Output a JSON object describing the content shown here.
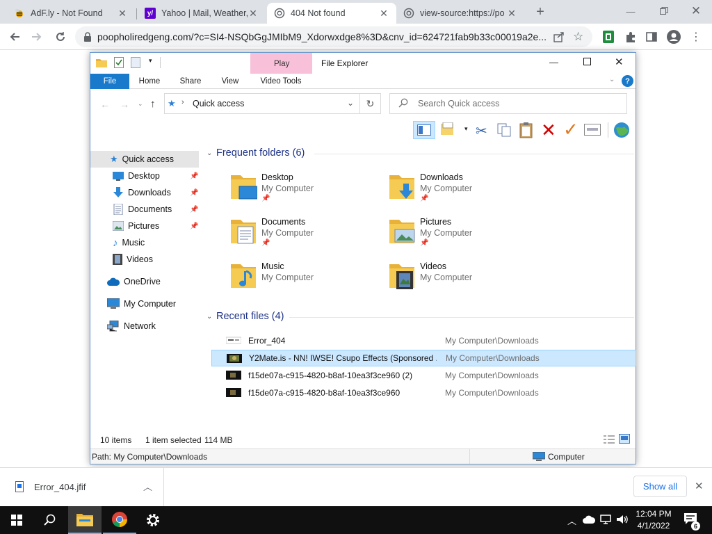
{
  "browser": {
    "tabs": [
      {
        "title": "AdF.ly - Not Found",
        "icon": "adfly-bee-icon"
      },
      {
        "title": "Yahoo | Mail, Weather,",
        "icon": "yahoo-icon"
      },
      {
        "title": "404 Not found",
        "icon": "globe-icon",
        "active": true
      },
      {
        "title": "view-source:https://po",
        "icon": "globe-icon"
      }
    ],
    "new_tab": "+",
    "url": "poopholiredgeng.com/?c=SI4-NSQbGgJMIbM9_Xdorwxdge8%3D&cnv_id=624721fab9b33c00019a2e..."
  },
  "explorer": {
    "title": "File Explorer",
    "contextual_tab": "Play",
    "ribbon_tabs": [
      "File",
      "Home",
      "Share",
      "View",
      "Video Tools"
    ],
    "address_path": "Quick access",
    "search_placeholder": "Search Quick access",
    "help": "?",
    "sidebar": [
      {
        "label": "Quick access",
        "icon": "star-icon"
      },
      {
        "label": "Desktop",
        "icon": "desktop-icon",
        "pinned": true
      },
      {
        "label": "Downloads",
        "icon": "download-icon",
        "pinned": true
      },
      {
        "label": "Documents",
        "icon": "documents-icon",
        "pinned": true
      },
      {
        "label": "Pictures",
        "icon": "pictures-icon",
        "pinned": true
      },
      {
        "label": "Music",
        "icon": "music-icon"
      },
      {
        "label": "Videos",
        "icon": "videos-icon"
      },
      {
        "label": "OneDrive",
        "icon": "cloud-icon"
      },
      {
        "label": "My Computer",
        "icon": "computer-icon"
      },
      {
        "label": "Network",
        "icon": "network-icon"
      }
    ],
    "frequent_header": "Frequent folders (6)",
    "folders": [
      {
        "name": "Desktop",
        "sub": "My Computer",
        "pin": "📌"
      },
      {
        "name": "Downloads",
        "sub": "My Computer",
        "pin": "📌"
      },
      {
        "name": "Documents",
        "sub": "My Computer",
        "pin": "📌"
      },
      {
        "name": "Pictures",
        "sub": "My Computer",
        "pin": "📌"
      },
      {
        "name": "Music",
        "sub": "My Computer"
      },
      {
        "name": "Videos",
        "sub": "My Computer"
      }
    ],
    "recent_header": "Recent files (4)",
    "recent": [
      {
        "name": "Error_404",
        "location": "My Computer\\Downloads"
      },
      {
        "name": "Y2Mate.is - NN! IWSE! Csupo Effects (Sponsored ...",
        "location": "My Computer\\Downloads",
        "selected": true
      },
      {
        "name": "f15de07a-c915-4820-b8af-10ea3f3ce960 (2)",
        "location": "My Computer\\Downloads"
      },
      {
        "name": "f15de07a-c915-4820-b8af-10ea3f3ce960",
        "location": "My Computer\\Downloads"
      }
    ],
    "status": {
      "count": "10 items",
      "selection": "1 item selected",
      "size": "114 MB"
    },
    "path_bar": "Path: My Computer\\Downloads",
    "path_right": "Computer"
  },
  "downloads": {
    "file": "Error_404.jfif",
    "show_all": "Show all"
  },
  "taskbar": {
    "time": "12:04 PM",
    "date": "4/1/2022",
    "notif_count": "6"
  }
}
